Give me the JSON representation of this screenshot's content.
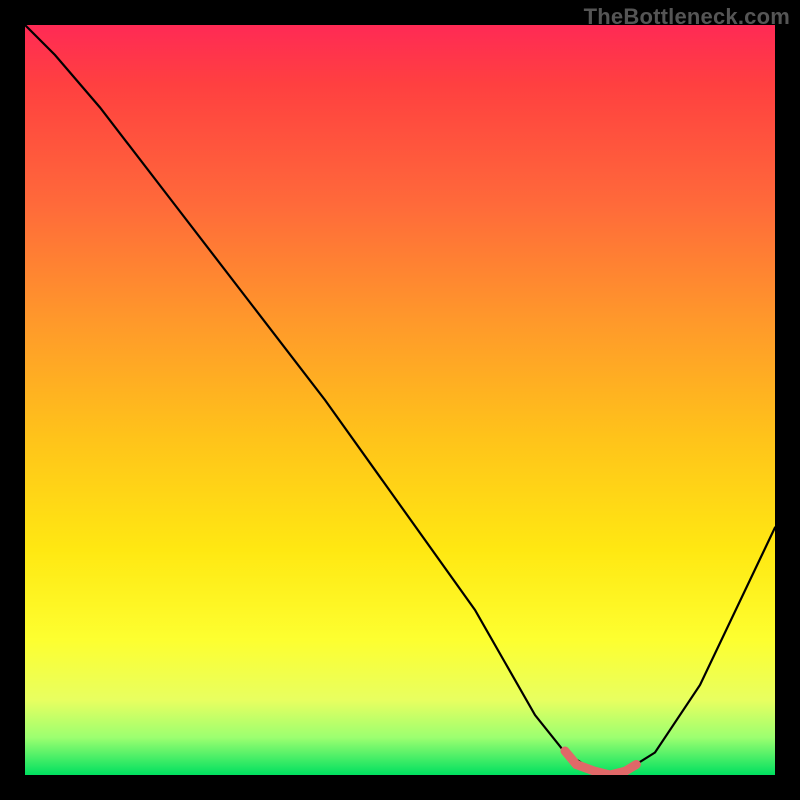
{
  "watermark": "TheBottleneck.com",
  "chart_data": {
    "type": "line",
    "title": "",
    "xlabel": "",
    "ylabel": "",
    "xlim": [
      0,
      100
    ],
    "ylim": [
      0,
      100
    ],
    "series": [
      {
        "name": "curve",
        "x": [
          0,
          4,
          10,
          20,
          30,
          40,
          50,
          60,
          64,
          68,
          72,
          76,
          78,
          80,
          84,
          90,
          100
        ],
        "y": [
          100,
          96,
          89,
          76,
          63,
          50,
          36,
          22,
          15,
          8,
          3,
          0.5,
          0,
          0.5,
          3,
          12,
          33
        ]
      },
      {
        "name": "highlight",
        "x": [
          72,
          73.5,
          76,
          78,
          80,
          81.5
        ],
        "y": [
          3.2,
          1.4,
          0.5,
          0,
          0.5,
          1.4
        ]
      }
    ],
    "colors": {
      "curve": "#000000",
      "highlight": "#e06868",
      "gradient_top": "#ff2a55",
      "gradient_bottom": "#00e060"
    }
  }
}
